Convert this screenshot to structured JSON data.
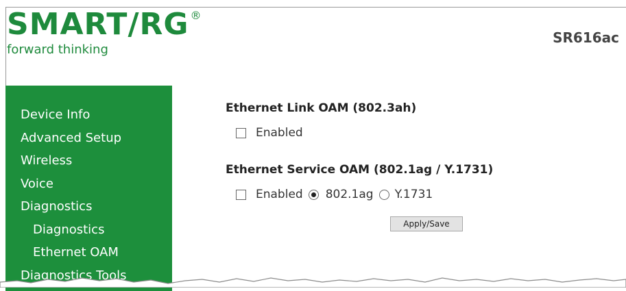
{
  "header": {
    "logo_text": "SMART/RG",
    "logo_registered": "®",
    "tagline": "forward thinking",
    "model": "SR616ac"
  },
  "sidebar": {
    "items": [
      {
        "label": "Device Info",
        "level": 0
      },
      {
        "label": "Advanced Setup",
        "level": 0
      },
      {
        "label": "Wireless",
        "level": 0
      },
      {
        "label": "Voice",
        "level": 0
      },
      {
        "label": "Diagnostics",
        "level": 0
      },
      {
        "label": "Diagnostics",
        "level": 1
      },
      {
        "label": "Ethernet OAM",
        "level": 1
      },
      {
        "label": "Diagnostics Tools",
        "level": 0
      }
    ]
  },
  "main": {
    "link_oam": {
      "title": "Ethernet Link OAM (802.3ah)",
      "enabled_label": "Enabled",
      "enabled": false
    },
    "service_oam": {
      "title": "Ethernet Service OAM (802.1ag / Y.1731)",
      "enabled_label": "Enabled",
      "enabled": false,
      "option_1": "802.1ag",
      "option_2": "Y.1731",
      "selected": "802.1ag"
    },
    "apply_label": "Apply/Save"
  },
  "colors": {
    "brand_green": "#1d8f3c",
    "sidebar_text": "#ffffff"
  }
}
